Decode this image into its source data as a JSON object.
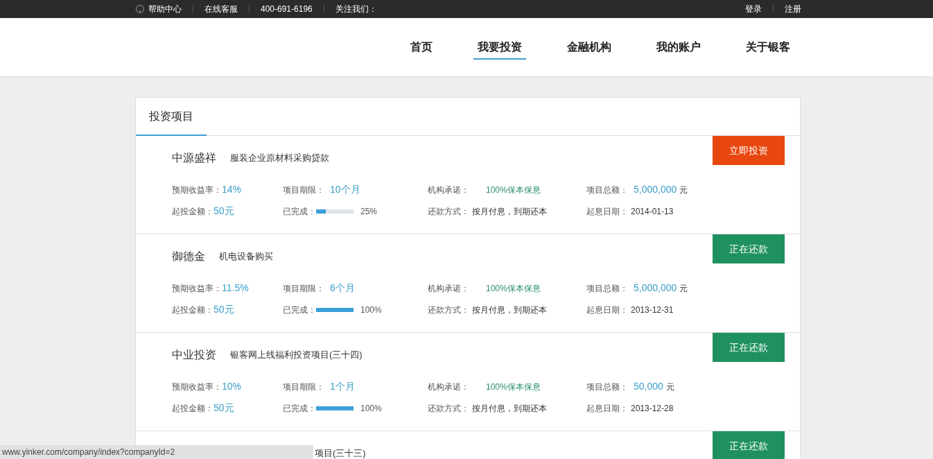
{
  "top_bar": {
    "left": [
      {
        "kind": "help",
        "label": "帮助中心"
      },
      {
        "kind": "text",
        "label": "在线客服"
      },
      {
        "kind": "text",
        "label": "400-691-6196"
      },
      {
        "kind": "text",
        "label": "关注我们："
      }
    ],
    "right": [
      "登录",
      "注册"
    ]
  },
  "nav": [
    {
      "label": "首页",
      "selected": false
    },
    {
      "label": "我要投资",
      "selected": true
    },
    {
      "label": "金融机构",
      "selected": false
    },
    {
      "label": "我的账户",
      "selected": false
    },
    {
      "label": "关于银客",
      "selected": false
    }
  ],
  "panel": {
    "tab": "投资项目",
    "projects": [
      {
        "name": "中源盛祥",
        "description": "服装企业原材料采购贷款",
        "button": {
          "label": "立即投资",
          "kind": "invest"
        },
        "stats": [
          {
            "label": "预期收益率：",
            "value": "14%",
            "kind": "rate"
          },
          {
            "label": "项目期限：",
            "value": "10个月",
            "kind": "term"
          },
          {
            "label": "机构承诺：",
            "value": "100%保本保息",
            "kind": "promise"
          },
          {
            "label": "项目总额：",
            "value": "5,000,000",
            "unit": "元",
            "kind": "amount"
          },
          {
            "label": "起投金额：",
            "value": "50元",
            "kind": "rate"
          },
          {
            "label": "已完成：",
            "value": "25%",
            "level": 0.25,
            "kind": "progress"
          },
          {
            "label": "还款方式：",
            "value": "按月付息，到期还本",
            "kind": "plain"
          },
          {
            "label": "起息日期：",
            "value": "2014-01-13",
            "kind": "plain"
          }
        ]
      },
      {
        "name": "御德金",
        "description": "机电设备购买",
        "button": {
          "label": "正在还款",
          "kind": "repaying"
        },
        "stats": [
          {
            "label": "预期收益率：",
            "value": "11.5%",
            "kind": "rate"
          },
          {
            "label": "项目期限：",
            "value": "6个月",
            "kind": "term"
          },
          {
            "label": "机构承诺：",
            "value": "100%保本保息",
            "kind": "promise"
          },
          {
            "label": "项目总额：",
            "value": "5,000,000",
            "unit": "元",
            "kind": "amount"
          },
          {
            "label": "起投金额：",
            "value": "50元",
            "kind": "rate"
          },
          {
            "label": "已完成：",
            "value": "100%",
            "level": 1,
            "kind": "progress"
          },
          {
            "label": "还款方式：",
            "value": "按月付息，到期还本",
            "kind": "plain"
          },
          {
            "label": "起息日期：",
            "value": "2013-12-31",
            "kind": "plain"
          }
        ]
      },
      {
        "name": "中业投资",
        "description": "银客网上线福利投资项目(三十四)",
        "button": {
          "label": "正在还款",
          "kind": "repaying"
        },
        "stats": [
          {
            "label": "预期收益率：",
            "value": "10%",
            "kind": "rate"
          },
          {
            "label": "项目期限：",
            "value": "1个月",
            "kind": "term"
          },
          {
            "label": "机构承诺：",
            "value": "100%保本保息",
            "kind": "promise"
          },
          {
            "label": "项目总额：",
            "value": "50,000",
            "unit": "元",
            "kind": "amount"
          },
          {
            "label": "起投金额：",
            "value": "50元",
            "kind": "rate"
          },
          {
            "label": "已完成：",
            "value": "100%",
            "level": 1,
            "kind": "progress"
          },
          {
            "label": "还款方式：",
            "value": "按月付息，到期还本",
            "kind": "plain"
          },
          {
            "label": "起息日期：",
            "value": "2013-12-28",
            "kind": "plain"
          }
        ]
      },
      {
        "description": "项目(三十三)",
        "button": {
          "label": "正在还款",
          "kind": "repaying"
        }
      }
    ]
  },
  "status_url": "www.yinker.com/company/index?companyId=2"
}
